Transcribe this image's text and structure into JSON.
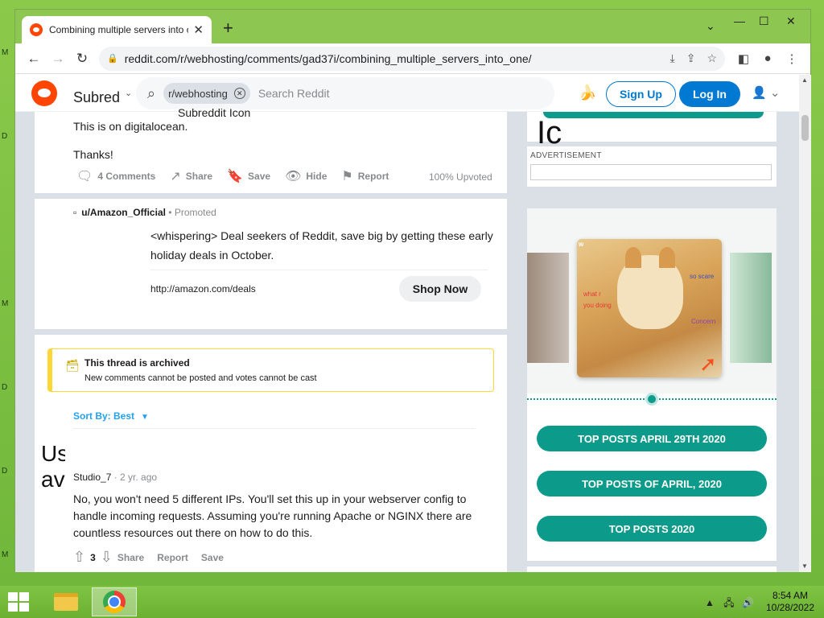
{
  "desktop": {
    "side_letters": [
      "M",
      "D",
      "M",
      "D",
      "D",
      "M"
    ]
  },
  "browser": {
    "tab_title": "Combining multiple servers into one",
    "tab_close": "✕",
    "new_tab": "+",
    "url": "reddit.com/r/webhosting/comments/gad37i/combining_multiple_servers_into_one/",
    "controls": {
      "minimize": "—",
      "maximize": "☐",
      "close": "✕",
      "chevron": "⌄"
    }
  },
  "reddit_header": {
    "subreddit_alt": "Subred",
    "chip_label": "r/webhosting",
    "chip_alt": "Subreddit Icon",
    "search_placeholder": "Search Reddit",
    "sign_up": "Sign Up",
    "log_in": "Log In"
  },
  "post": {
    "text_line": "This is on digitalocean.",
    "thanks": "Thanks!",
    "comments": "4 Comments",
    "share": "Share",
    "save": "Save",
    "hide": "Hide",
    "report": "Report",
    "upvoted": "100% Upvoted"
  },
  "promoted": {
    "user": "u/Amazon_Official",
    "tag": "• Promoted",
    "body": "<whispering> Deal seekers of Reddit, save big by getting these early holiday deals in October.",
    "link": "http://amazon.com/deals",
    "cta": "Shop Now"
  },
  "archived": {
    "title": "This thread is archived",
    "subtitle": "New comments cannot be posted and votes cannot be cast"
  },
  "sort": {
    "label": "Sort By: Best"
  },
  "comment": {
    "avatar_alt": "User avatar",
    "author": "Studio_7",
    "time": "· 2 yr. ago",
    "body": "No, you won't need 5 different IPs. You'll set this up in your webserver config to handle incoming requests. Assuming you're running Apache or NGINX there are countless resources out there on how to do this.",
    "score": "3",
    "share": "Share",
    "report": "Report",
    "save": "Save"
  },
  "sidebar": {
    "icon_alt": "Ic",
    "ad_label": "ADVERTISEMENT",
    "meme_words": [
      "w",
      "what r",
      "you doing",
      "so scare",
      "Concern"
    ],
    "buttons": [
      "TOP POSTS APRIL 29TH 2020",
      "TOP POSTS OF APRIL, 2020",
      "TOP POSTS 2020"
    ]
  },
  "taskbar": {
    "time": "8:54 AM",
    "date": "10/28/2022"
  },
  "colors": {
    "accent": "#0079d3",
    "reddit_orange": "#ff4500",
    "teal": "#0c9a8a"
  }
}
